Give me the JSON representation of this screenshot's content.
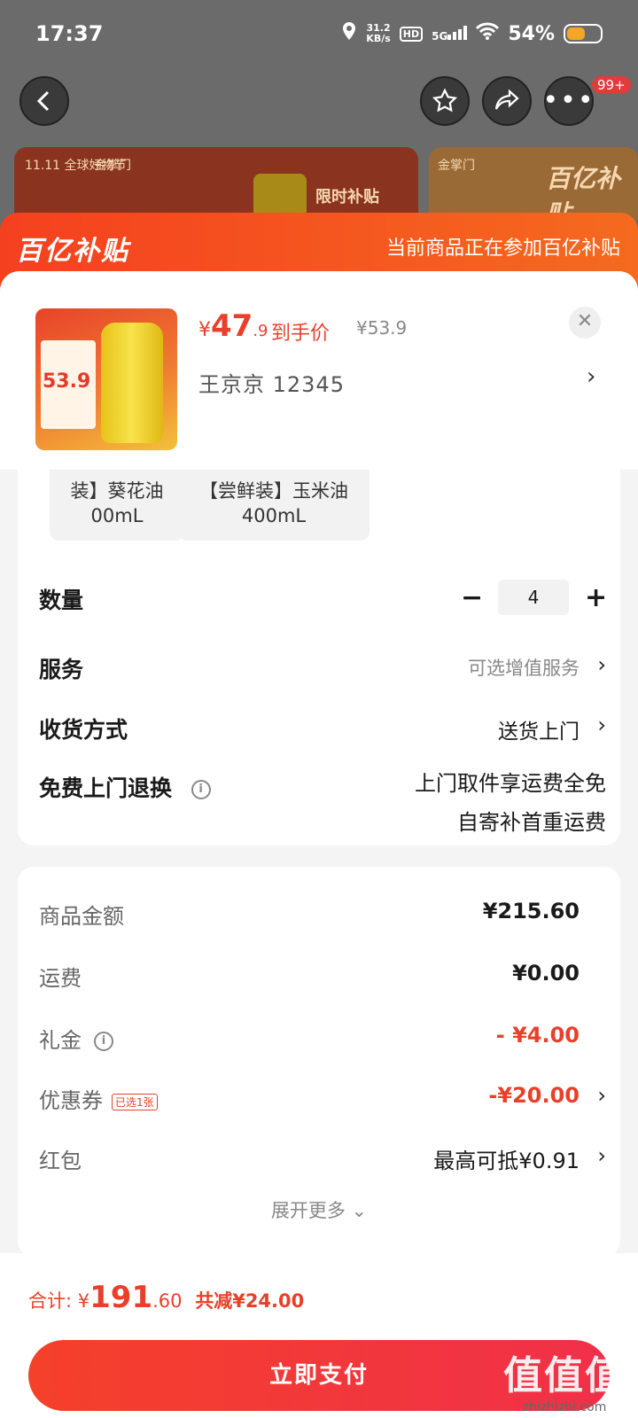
{
  "status_bar": {
    "time": "17:37",
    "net_speed_top": "31.2",
    "net_speed_bottom": "KB/s",
    "hd": "HD",
    "signal": "5G",
    "battery": "54%"
  },
  "nav": {
    "back_icon": "back-arrow-icon",
    "badge": "99+"
  },
  "banner": {
    "tag1": "11.11 全球好物节",
    "tag2": "金掌门",
    "tag3": "限时补贴",
    "tag4": "金掌门",
    "tag5": "百亿补贴"
  },
  "subsidy": {
    "logo": "百亿补贴",
    "note": "当前商品正在参加百亿补贴"
  },
  "product": {
    "thumb_price": "53.9",
    "currency": "¥",
    "price_int": "47",
    "price_dec": ".9",
    "price_label": "到手价",
    "price_old": "¥53.9",
    "seller": "王京京  12345"
  },
  "options": [
    {
      "line1": "装】葵花油",
      "line2": "00mL"
    },
    {
      "line1": "【尝鲜装】玉米油",
      "line2": "400mL"
    }
  ],
  "quantity": {
    "label": "数量",
    "value": "4",
    "minus": "−",
    "plus": "+"
  },
  "service": {
    "label": "服务",
    "value": "可选增值服务"
  },
  "delivery": {
    "label": "收货方式",
    "value": "送货上门"
  },
  "return": {
    "label": "免费上门退换",
    "info": "i",
    "line1": "上门取件享运费全免",
    "line2": "自寄补首重运费"
  },
  "fees": {
    "goods_label": "商品金额",
    "goods_value": "¥215.60",
    "shipping_label": "运费",
    "shipping_value": "¥0.00",
    "gift_label": "礼金",
    "gift_value": "- ¥4.00",
    "coupon_label": "优惠券",
    "coupon_badge": "已选1张",
    "coupon_value": "-¥20.00",
    "redpack_label": "红包",
    "redpack_value": "最高可抵¥0.91",
    "expand": "展开更多 ⌄"
  },
  "summary": {
    "total_label": "合计: ¥",
    "total_int": "191",
    "total_dec": ".60",
    "discount": "共减¥24.00"
  },
  "pay_button": "立即支付",
  "watermark": {
    "main": "值值值",
    "sub": "zhizhizhi.com"
  },
  "colors": {
    "accent": "#e8402a",
    "subsidy_start": "#f5401f",
    "subsidy_end": "#f56a1f"
  }
}
